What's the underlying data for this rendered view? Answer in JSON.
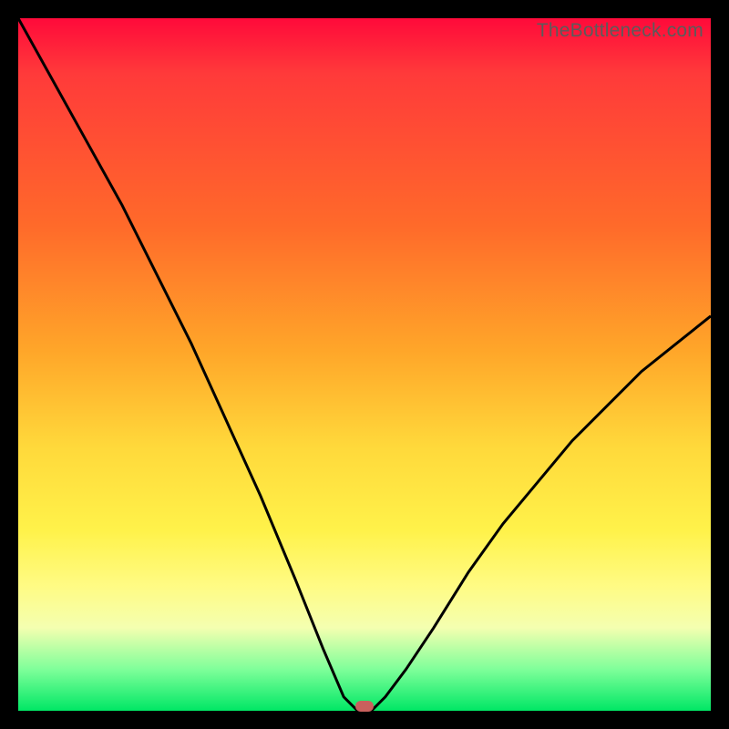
{
  "watermark": "TheBottleneck.com",
  "colors": {
    "frame": "#000000",
    "curve": "#000000",
    "marker": "#c9605d",
    "gradient_top": "#ff0a3a",
    "gradient_bottom": "#00e765"
  },
  "chart_data": {
    "type": "line",
    "title": "",
    "xlabel": "",
    "ylabel": "",
    "xlim": [
      0,
      100
    ],
    "ylim": [
      0,
      100
    ],
    "grid": false,
    "legend": false,
    "note": "x and y are percent of plot area; y=0 is bottom (green), y=100 is top (red). Curve is V-shaped with minimum near x≈49; left branch reaches top-left, right branch rises to ~y≈57 at x=100.",
    "series": [
      {
        "name": "bottleneck-curve",
        "x": [
          0,
          5,
          10,
          15,
          20,
          25,
          30,
          35,
          40,
          44,
          47,
          49,
          51,
          53,
          56,
          60,
          65,
          70,
          75,
          80,
          85,
          90,
          95,
          100
        ],
        "y": [
          100,
          91,
          82,
          73,
          63,
          53,
          42,
          31,
          19,
          9,
          2,
          0,
          0,
          2,
          6,
          12,
          20,
          27,
          33,
          39,
          44,
          49,
          53,
          57
        ]
      }
    ],
    "marker": {
      "x": 50,
      "y": 0.6
    }
  }
}
